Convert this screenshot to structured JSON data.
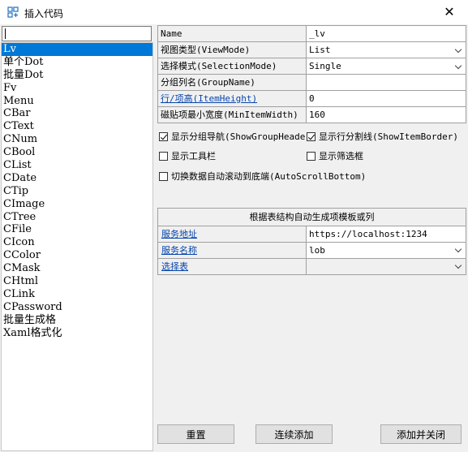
{
  "window": {
    "title": "插入代码",
    "close_glyph": "✕",
    "icon": "insert-code-icon"
  },
  "search": {
    "value": "",
    "placeholder": ""
  },
  "list_items": [
    "Lv",
    "单个Dot",
    "批量Dot",
    "Fv",
    "Menu",
    "CBar",
    "CText",
    "CNum",
    "CBool",
    "CList",
    "CDate",
    "CTip",
    "CImage",
    "CTree",
    "CFile",
    "CIcon",
    "CColor",
    "CMask",
    "CHtml",
    "CLink",
    "CPassword",
    "批量生成格",
    "Xaml格式化"
  ],
  "selected_index": 0,
  "properties": [
    {
      "label": "Name",
      "value": "_lv",
      "link": false,
      "combo": false
    },
    {
      "label": "视图类型(ViewMode)",
      "value": "List",
      "link": false,
      "combo": true
    },
    {
      "label": "选择模式(SelectionMode)",
      "value": "Single",
      "link": false,
      "combo": true
    },
    {
      "label": "分组列名(GroupName)",
      "value": "",
      "link": false,
      "combo": false
    },
    {
      "label": "行/项高(ItemHeight)",
      "value": "0",
      "link": true,
      "combo": false
    },
    {
      "label": "磁贴项最小宽度(MinItemWidth)",
      "value": "160",
      "link": false,
      "combo": false
    }
  ],
  "checkboxes": [
    {
      "label": "显示分组导航(ShowGroupHeader)",
      "checked": true
    },
    {
      "label": "显示行分割线(ShowItemBorder)",
      "checked": true
    },
    {
      "label": "显示工具栏",
      "checked": false
    },
    {
      "label": "显示筛选框",
      "checked": false
    },
    {
      "label": "切换数据自动滚动到底端(AutoScrollBottom)",
      "checked": false
    }
  ],
  "generator": {
    "title": "根据表结构自动生成项模板或列",
    "rows": [
      {
        "label": "服务地址",
        "value": "https://localhost:1234",
        "combo": false,
        "disabled": false
      },
      {
        "label": "服务名称",
        "value": "lob",
        "combo": true,
        "disabled": false
      },
      {
        "label": "选择表",
        "value": "",
        "combo": true,
        "disabled": true
      }
    ]
  },
  "buttons": {
    "reset": "重置",
    "add_continue": "连续添加",
    "add_close": "添加并关闭"
  }
}
